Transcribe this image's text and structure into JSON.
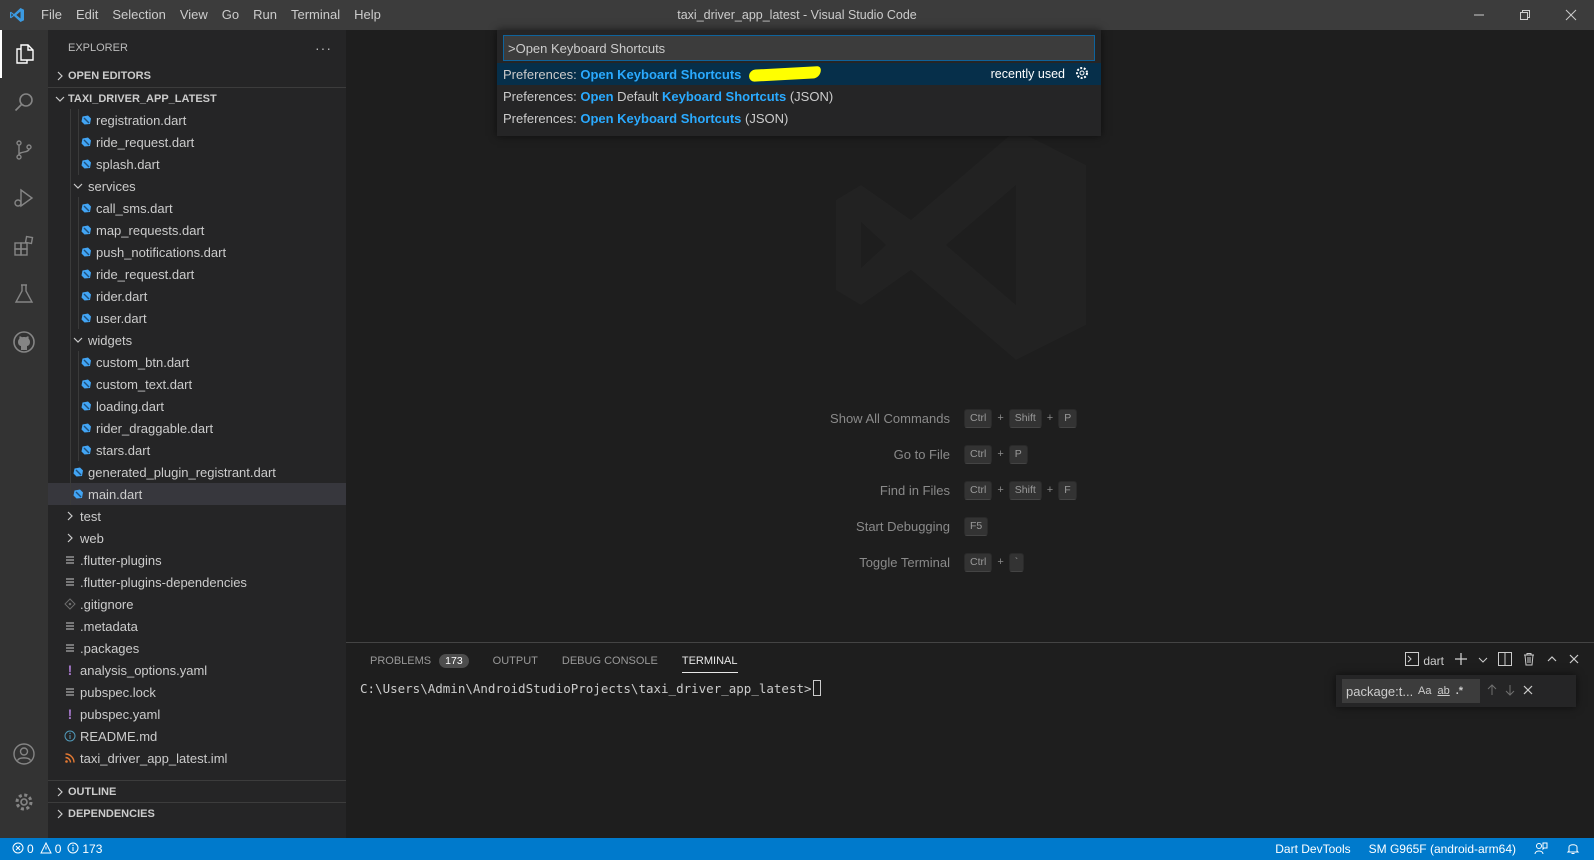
{
  "window": {
    "title": "taxi_driver_app_latest - Visual Studio Code",
    "menus": [
      "File",
      "Edit",
      "Selection",
      "View",
      "Go",
      "Run",
      "Terminal",
      "Help"
    ]
  },
  "activity_bar": {
    "items": [
      "explorer-icon",
      "search-icon",
      "source-control-icon",
      "run-debug-icon",
      "extensions-icon",
      "testing-icon",
      "github-icon"
    ],
    "bottom": [
      "account-icon",
      "settings-gear-icon"
    ]
  },
  "explorer": {
    "title": "EXPLORER",
    "more": "···",
    "open_editors": "OPEN EDITORS",
    "project": "TAXI_DRIVER_APP_LATEST",
    "tree": [
      {
        "name": "registration.dart",
        "type": "dart",
        "depth": 2
      },
      {
        "name": "ride_request.dart",
        "type": "dart",
        "depth": 2
      },
      {
        "name": "splash.dart",
        "type": "dart",
        "depth": 2
      },
      {
        "name": "services",
        "type": "folder-open",
        "depth": 1
      },
      {
        "name": "call_sms.dart",
        "type": "dart",
        "depth": 2
      },
      {
        "name": "map_requests.dart",
        "type": "dart",
        "depth": 2
      },
      {
        "name": "push_notifications.dart",
        "type": "dart",
        "depth": 2
      },
      {
        "name": "ride_request.dart",
        "type": "dart",
        "depth": 2
      },
      {
        "name": "rider.dart",
        "type": "dart",
        "depth": 2
      },
      {
        "name": "user.dart",
        "type": "dart",
        "depth": 2
      },
      {
        "name": "widgets",
        "type": "folder-open",
        "depth": 1
      },
      {
        "name": "custom_btn.dart",
        "type": "dart",
        "depth": 2
      },
      {
        "name": "custom_text.dart",
        "type": "dart",
        "depth": 2
      },
      {
        "name": "loading.dart",
        "type": "dart",
        "depth": 2
      },
      {
        "name": "rider_draggable.dart",
        "type": "dart",
        "depth": 2
      },
      {
        "name": "stars.dart",
        "type": "dart",
        "depth": 2
      },
      {
        "name": "generated_plugin_registrant.dart",
        "type": "dart",
        "depth": 1
      },
      {
        "name": "main.dart",
        "type": "dart",
        "depth": 1,
        "selected": true
      },
      {
        "name": "test",
        "type": "folder",
        "depth": 0
      },
      {
        "name": "web",
        "type": "folder",
        "depth": 0
      },
      {
        "name": ".flutter-plugins",
        "type": "lines",
        "depth": 0
      },
      {
        "name": ".flutter-plugins-dependencies",
        "type": "lines",
        "depth": 0
      },
      {
        "name": ".gitignore",
        "type": "git",
        "depth": 0
      },
      {
        "name": ".metadata",
        "type": "lines",
        "depth": 0
      },
      {
        "name": ".packages",
        "type": "lines",
        "depth": 0
      },
      {
        "name": "analysis_options.yaml",
        "type": "yaml",
        "depth": 0
      },
      {
        "name": "pubspec.lock",
        "type": "lines",
        "depth": 0
      },
      {
        "name": "pubspec.yaml",
        "type": "yaml",
        "depth": 0
      },
      {
        "name": "README.md",
        "type": "info",
        "depth": 0
      },
      {
        "name": "taxi_driver_app_latest.iml",
        "type": "rss",
        "depth": 0
      }
    ],
    "outline": "OUTLINE",
    "dependencies": "DEPENDENCIES"
  },
  "command_palette": {
    "input_value": ">Open Keyboard Shortcuts",
    "results": [
      {
        "prefix": "Preferences: ",
        "parts": [
          [
            "Open Keyboard Shortcuts",
            true
          ]
        ],
        "recent": "recently used",
        "focused": true
      },
      {
        "prefix": "Preferences: ",
        "parts": [
          [
            "Open",
            true
          ],
          [
            " Default ",
            false
          ],
          [
            "Keyboard Shortcuts",
            true
          ],
          [
            " (JSON)",
            false
          ]
        ]
      },
      {
        "prefix": "Preferences: ",
        "parts": [
          [
            "Open Keyboard Shortcuts",
            true
          ],
          [
            " (JSON)",
            false
          ]
        ]
      }
    ]
  },
  "welcome_shortcuts": [
    {
      "label": "Show All Commands",
      "keys": [
        "Ctrl",
        "Shift",
        "P"
      ]
    },
    {
      "label": "Go to File",
      "keys": [
        "Ctrl",
        "P"
      ]
    },
    {
      "label": "Find in Files",
      "keys": [
        "Ctrl",
        "Shift",
        "F"
      ]
    },
    {
      "label": "Start Debugging",
      "keys": [
        "F5"
      ]
    },
    {
      "label": "Toggle Terminal",
      "keys": [
        "Ctrl",
        "`"
      ]
    }
  ],
  "panel": {
    "tabs": [
      {
        "label": "PROBLEMS",
        "badge": "173"
      },
      {
        "label": "OUTPUT"
      },
      {
        "label": "DEBUG CONSOLE"
      },
      {
        "label": "TERMINAL",
        "active": true
      }
    ],
    "terminal_name": "dart",
    "prompt": "C:\\Users\\Admin\\AndroidStudioProjects\\taxi_driver_app_latest>",
    "find": {
      "value": "package:t...",
      "options": [
        "Aa",
        "ab",
        ".*"
      ]
    }
  },
  "status_bar": {
    "errors": "0",
    "warnings": "0",
    "info": "173",
    "right": [
      "Dart DevTools",
      "SM G965F (android-arm64)"
    ]
  },
  "colors": {
    "accent": "#007acc",
    "highlight": "#2aaaff",
    "dart_icon": "#42a5f5",
    "yaml_icon": "#a074c4",
    "rss_icon": "#e37933"
  }
}
